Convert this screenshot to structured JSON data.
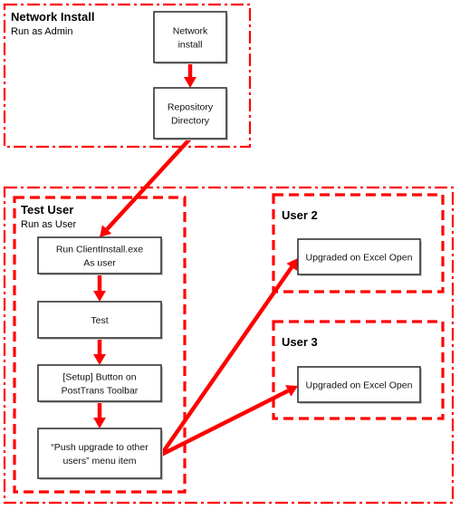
{
  "colors": {
    "accent": "#ff0000",
    "box_border": "#333333",
    "text": "#000000",
    "background": "#ffffff"
  },
  "groups": {
    "network_install": {
      "title": "Network Install",
      "subtitle": "Run as Admin"
    },
    "test_user": {
      "title": "Test User",
      "subtitle": "Run as User"
    },
    "user2": {
      "title": "User 2"
    },
    "user3": {
      "title": "User 3"
    }
  },
  "nodes": {
    "network_install": {
      "lines": [
        "Network",
        "install"
      ]
    },
    "repository_directory": {
      "lines": [
        "Repository",
        "Directory"
      ]
    },
    "run_clientinstall": {
      "lines": [
        "Run ClientInstall.exe",
        "As user"
      ]
    },
    "test": {
      "lines": [
        "Test"
      ]
    },
    "setup_button": {
      "lines": [
        "[Setup] Button on",
        "PostTrans Toolbar"
      ]
    },
    "push_upgrade": {
      "lines": [
        "“Push upgrade to other",
        "users” menu item"
      ]
    },
    "user2_upgraded": {
      "lines": [
        "Upgraded on Excel Open"
      ]
    },
    "user3_upgraded": {
      "lines": [
        "Upgraded on Excel Open"
      ]
    }
  },
  "edges": [
    {
      "from": "network_install",
      "to": "repository_directory"
    },
    {
      "from": "repository_directory",
      "to": "run_clientinstall"
    },
    {
      "from": "run_clientinstall",
      "to": "test"
    },
    {
      "from": "test",
      "to": "setup_button"
    },
    {
      "from": "setup_button",
      "to": "push_upgrade"
    },
    {
      "from": "push_upgrade",
      "to": "user2_upgraded"
    },
    {
      "from": "push_upgrade",
      "to": "user3_upgraded"
    }
  ]
}
